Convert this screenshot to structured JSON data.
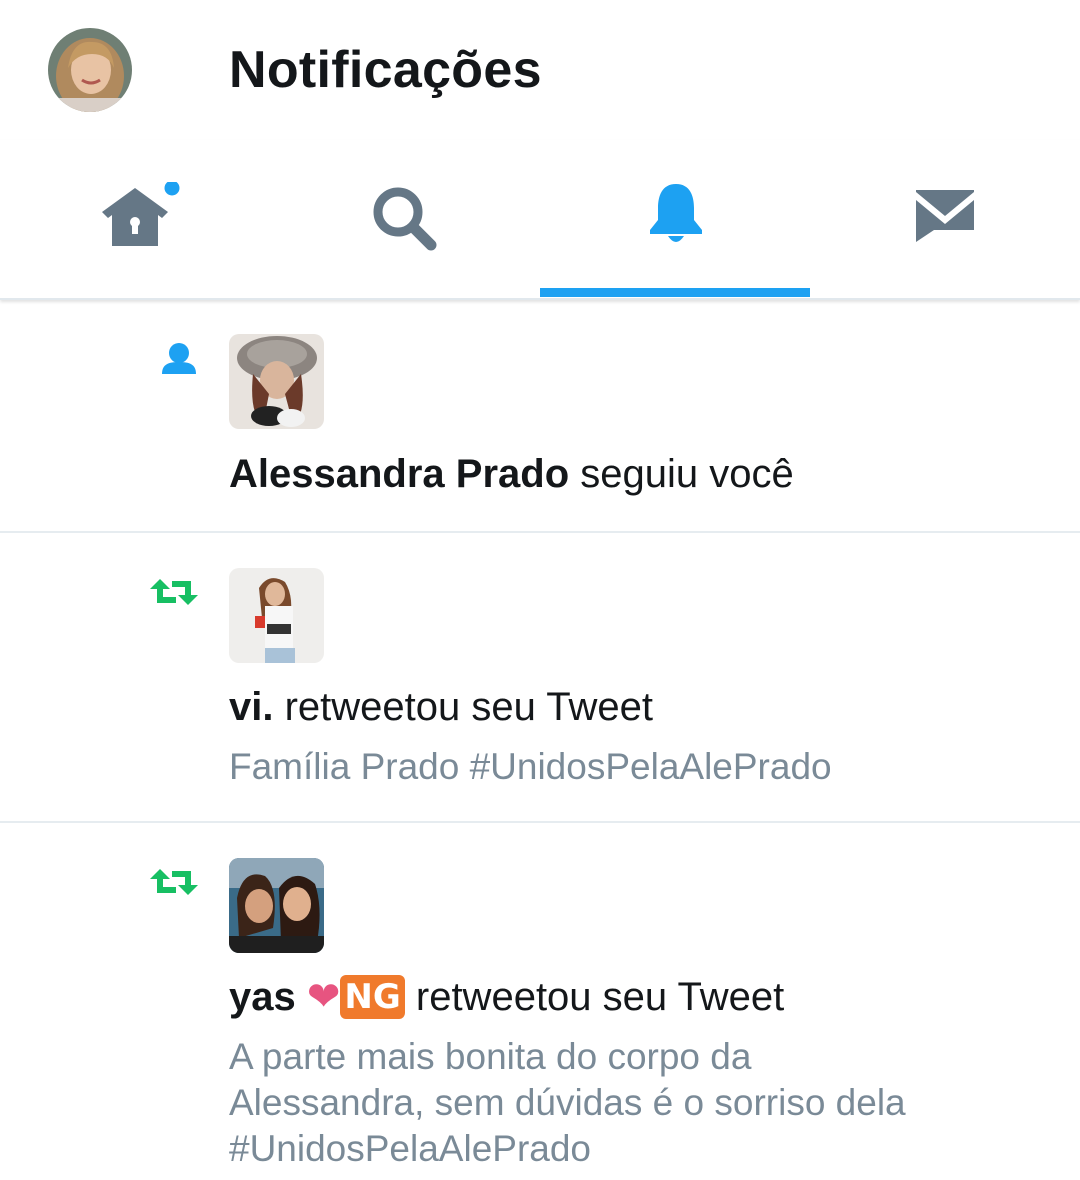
{
  "header": {
    "title": "Notificações",
    "avatar_icon": "profile-avatar"
  },
  "tabs": [
    {
      "name": "home",
      "icon": "home-icon",
      "has_badge": true,
      "active": false
    },
    {
      "name": "search",
      "icon": "search-icon",
      "active": false
    },
    {
      "name": "notifications",
      "icon": "bell-icon",
      "active": true
    },
    {
      "name": "messages",
      "icon": "mail-icon",
      "active": false
    }
  ],
  "colors": {
    "accent": "#1da1f2",
    "retweet": "#17bf63",
    "tab_icon": "#657786",
    "subtext": "#7a8a97"
  },
  "notifications": [
    {
      "type": "follow",
      "icon": "person-icon",
      "name": "Alessandra Prado",
      "action": " seguiu você",
      "sub": ""
    },
    {
      "type": "retweet",
      "icon": "retweet-icon",
      "name": "vi.",
      "action": " retweetou seu Tweet",
      "sub": "Família Prado #UnidosPelaAlePrado"
    },
    {
      "type": "retweet",
      "icon": "retweet-icon",
      "name": "yas",
      "name_emoji": "❤",
      "name_badge": "NG",
      "action": " retweetou seu Tweet",
      "sub_lines": [
        "A parte mais bonita do corpo da",
        "Alessandra, sem dúvidas é o sorriso dela",
        "#UnidosPelaAlePrado"
      ]
    }
  ]
}
